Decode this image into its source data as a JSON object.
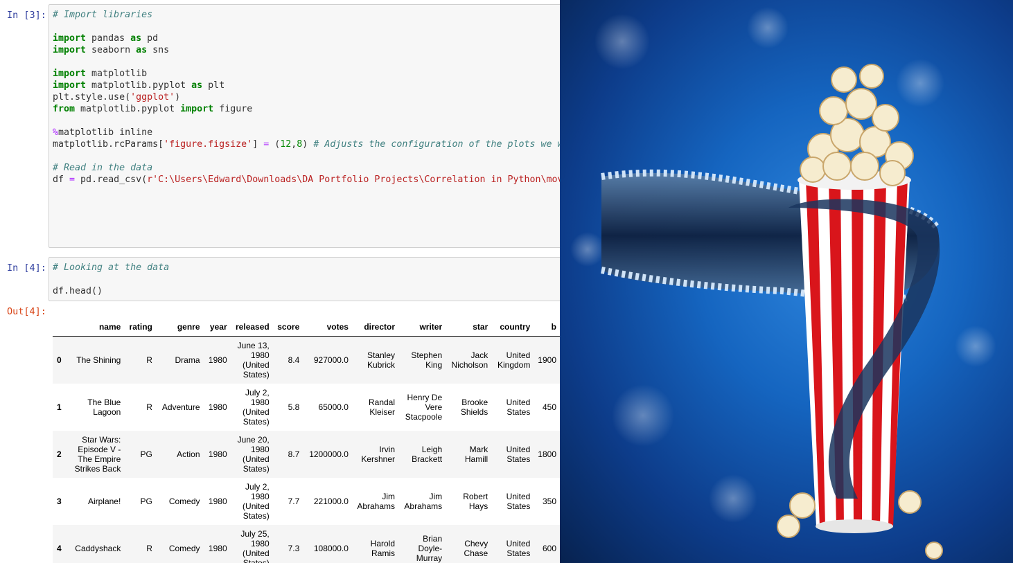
{
  "cells": [
    {
      "prompt": "In [3]:",
      "lines": [
        [
          {
            "t": "# Import libraries",
            "c": "cm"
          }
        ],
        [],
        [
          {
            "t": "import",
            "c": "kw"
          },
          {
            "t": " pandas "
          },
          {
            "t": "as",
            "c": "kw"
          },
          {
            "t": " pd"
          }
        ],
        [
          {
            "t": "import",
            "c": "kw"
          },
          {
            "t": " seaborn "
          },
          {
            "t": "as",
            "c": "kw"
          },
          {
            "t": " sns"
          }
        ],
        [],
        [
          {
            "t": "import",
            "c": "kw"
          },
          {
            "t": " matplotlib"
          }
        ],
        [
          {
            "t": "import",
            "c": "kw"
          },
          {
            "t": " matplotlib.pyplot "
          },
          {
            "t": "as",
            "c": "kw"
          },
          {
            "t": " plt"
          }
        ],
        [
          {
            "t": "plt.style.use("
          },
          {
            "t": "'ggplot'",
            "c": "st"
          },
          {
            "t": ")"
          }
        ],
        [
          {
            "t": "from",
            "c": "kw"
          },
          {
            "t": " matplotlib.pyplot "
          },
          {
            "t": "import",
            "c": "kw"
          },
          {
            "t": " figure"
          }
        ],
        [],
        [
          {
            "t": "%",
            "c": "mg"
          },
          {
            "t": "matplotlib inline"
          }
        ],
        [
          {
            "t": "matplotlib.rcParams["
          },
          {
            "t": "'figure.figsize'",
            "c": "st"
          },
          {
            "t": "] "
          },
          {
            "t": "=",
            "c": "mg"
          },
          {
            "t": " ("
          },
          {
            "t": "12",
            "c": "nm"
          },
          {
            "t": ","
          },
          {
            "t": "8",
            "c": "nm"
          },
          {
            "t": ") "
          },
          {
            "t": "# Adjusts the configuration of the plots we will",
            "c": "cm"
          }
        ],
        [],
        [
          {
            "t": "# Read in the data",
            "c": "cm"
          }
        ],
        [
          {
            "t": "df "
          },
          {
            "t": "=",
            "c": "mg"
          },
          {
            "t": " pd.read_csv("
          },
          {
            "t": "r'C:\\Users\\Edward\\Downloads\\DA Portfolio Projects\\Correlation in Python\\movies",
            "c": "st"
          }
        ]
      ]
    },
    {
      "prompt": "In [4]:",
      "lines": [
        [
          {
            "t": "# Looking at the data",
            "c": "cm"
          }
        ],
        [],
        [
          {
            "t": "df.head()"
          }
        ]
      ]
    }
  ],
  "output_prompt": "Out[4]:",
  "table": {
    "columns": [
      "",
      "name",
      "rating",
      "genre",
      "year",
      "released",
      "score",
      "votes",
      "director",
      "writer",
      "star",
      "country",
      "b"
    ],
    "rows": [
      [
        "0",
        "The Shining",
        "R",
        "Drama",
        "1980",
        "June 13, 1980 (United States)",
        "8.4",
        "927000.0",
        "Stanley Kubrick",
        "Stephen King",
        "Jack Nicholson",
        "United Kingdom",
        "1900"
      ],
      [
        "1",
        "The Blue Lagoon",
        "R",
        "Adventure",
        "1980",
        "July 2, 1980 (United States)",
        "5.8",
        "65000.0",
        "Randal Kleiser",
        "Henry De Vere Stacpoole",
        "Brooke Shields",
        "United States",
        "450"
      ],
      [
        "2",
        "Star Wars: Episode V - The Empire Strikes Back",
        "PG",
        "Action",
        "1980",
        "June 20, 1980 (United States)",
        "8.7",
        "1200000.0",
        "Irvin Kershner",
        "Leigh Brackett",
        "Mark Hamill",
        "United States",
        "1800"
      ],
      [
        "3",
        "Airplane!",
        "PG",
        "Comedy",
        "1980",
        "July 2, 1980 (United States)",
        "7.7",
        "221000.0",
        "Jim Abrahams",
        "Jim Abrahams",
        "Robert Hays",
        "United States",
        "350"
      ],
      [
        "4",
        "Caddyshack",
        "R",
        "Comedy",
        "1980",
        "July 25, 1980 (United States)",
        "7.3",
        "108000.0",
        "Harold Ramis",
        "Brian Doyle-Murray",
        "Chevy Chase",
        "United States",
        "600"
      ]
    ]
  },
  "colors": {
    "prompt_in": "#303f9f",
    "prompt_out": "#d84315",
    "cell_bg": "#f7f7f7",
    "keyword": "#008000",
    "comment": "#408080",
    "string": "#ba2121",
    "image_bg": "#1565c0"
  },
  "image": {
    "description_icon": "popcorn-film-reel-image"
  }
}
